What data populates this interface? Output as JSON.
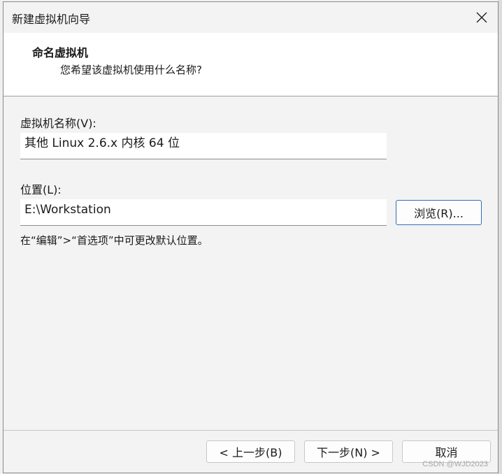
{
  "window": {
    "title": "新建虚拟机向导"
  },
  "header": {
    "heading": "命名虚拟机",
    "subheading": "您希望该虚拟机使用什么名称?"
  },
  "form": {
    "name_label": "虚拟机名称(V):",
    "name_value": "其他 Linux 2.6.x 内核 64 位",
    "location_label": "位置(L):",
    "location_value": "E:\\Workstation",
    "browse_label": "浏览(R)...",
    "hint": "在“编辑”>“首选项”中可更改默认位置。"
  },
  "footer": {
    "back_label": "< 上一步(B)",
    "next_label": "下一步(N) >",
    "cancel_label": "取消"
  },
  "watermark": "CSDN @WJD2023",
  "icons": {
    "close": "close-icon"
  }
}
